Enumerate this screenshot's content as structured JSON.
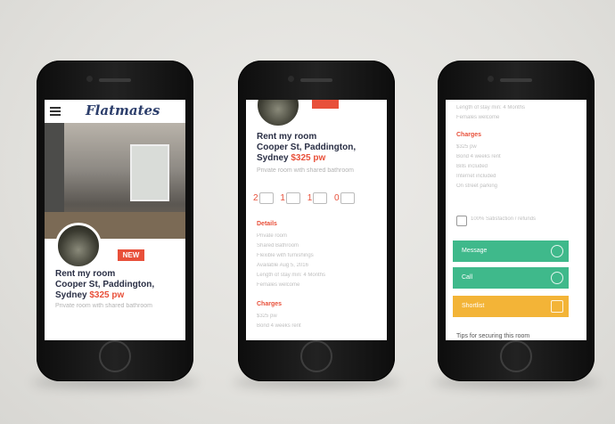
{
  "app": {
    "logo_text": "Flatmates"
  },
  "listing": {
    "title_line1": "Rent my room",
    "title_line2": "Cooper St, Paddington,",
    "title_line3_prefix": "Sydney",
    "price": "$325 pw",
    "subtitle": "Private room with shared bathroom",
    "badge": "NEW"
  },
  "features": {
    "bedrooms": "2",
    "bathrooms": "1",
    "residents": "1",
    "parking": "0"
  },
  "details": {
    "heading": "Details",
    "items": [
      "Private room",
      "Shared Bathroom",
      "Flexible with furnishings",
      "Available Aug 5, 2016",
      "Length of stay min: 4 Months",
      "Females welcome"
    ]
  },
  "charges": {
    "heading": "Charges",
    "items": [
      "$325 pw",
      "Bond 4 weeks rent",
      "Bills included",
      "Internet included",
      "On street parking"
    ]
  },
  "phone3_top": {
    "line1": "Length of stay min: 4 Months",
    "line2": "Females welcome"
  },
  "verified_text": "100% Satisfaction / refunds",
  "actions": {
    "message": "Message",
    "call": "Call",
    "share": "Shortlist"
  },
  "tips": "Tips for securing this room",
  "colors": {
    "accent": "#e8503a",
    "green": "#3fb98b",
    "yellow": "#f3b437",
    "navy": "#2a2f45"
  }
}
